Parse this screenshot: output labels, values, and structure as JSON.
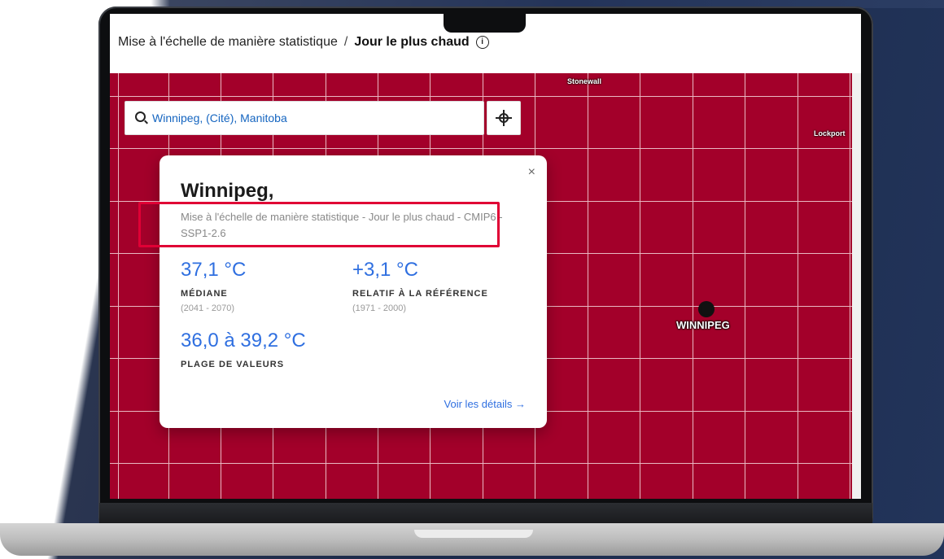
{
  "breadcrumb": {
    "parent": "Mise à l'échelle de manière statistique",
    "separator": "/",
    "current": "Jour le plus chaud"
  },
  "search": {
    "value": "Winnipeg, (Cité), Manitoba",
    "icon": "search-icon"
  },
  "map": {
    "towns": [
      "Stonewall",
      "Lockport"
    ],
    "marker_label": "WINNIPEG",
    "color": "#a3002a"
  },
  "popup": {
    "title": "Winnipeg,",
    "subtitle": "Mise à l'échelle de manière statistique - Jour le plus chaud - CMIP6 - SSP1-2.6",
    "median_value": "37,1 °C",
    "median_label": "MÉDIANE",
    "median_period": "(2041 - 2070)",
    "delta_value": "+3,1 °C",
    "delta_label": "RELATIF À LA RÉFÉRENCE",
    "delta_period": "(1971 - 2000)",
    "range_value": "36,0 à 39,2 °C",
    "range_label": "PLAGE DE VALEURS",
    "details_link": "Voir les détails",
    "close": "×",
    "details_arrow": "→"
  },
  "colors": {
    "accent": "#2f6fe0",
    "highlight": "#e00035"
  }
}
